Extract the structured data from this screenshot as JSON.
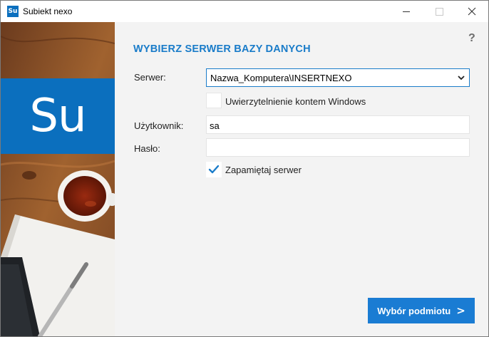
{
  "window": {
    "title": "Subiekt nexo",
    "app_icon_text": "Su"
  },
  "sidebar": {
    "logo_text": "Su",
    "logo_color": "#0b6fbe"
  },
  "dialog": {
    "help_label": "?",
    "heading": "WYBIERZ SERWER BAZY DANYCH",
    "accent_color": "#1a7cc9",
    "server": {
      "label": "Serwer:",
      "value": "Nazwa_Komputera\\INSERTNEXO"
    },
    "windows_auth": {
      "label": "Uwierzytelnienie kontem Windows",
      "checked": false
    },
    "user": {
      "label": "Użytkownik:",
      "value": "sa"
    },
    "password": {
      "label": "Hasło:",
      "value": ""
    },
    "remember": {
      "label": "Zapamiętaj serwer",
      "checked": true
    },
    "next_button": {
      "label": "Wybór podmiotu",
      "arrow": ">"
    }
  }
}
